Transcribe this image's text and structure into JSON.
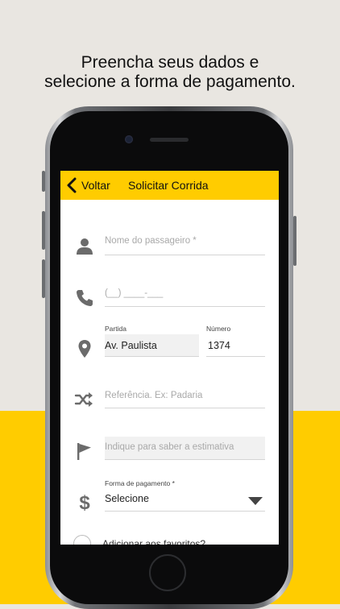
{
  "promo": {
    "line1": "Preencha seus dados e",
    "line2": "selecione a forma de pagamento."
  },
  "header": {
    "back_label": "Voltar",
    "title": "Solicitar Corrida"
  },
  "form": {
    "passenger": {
      "icon": "person-icon",
      "placeholder": "Nome do passageiro *"
    },
    "phone": {
      "icon": "phone-icon",
      "placeholder": "(__) ____-___"
    },
    "origin": {
      "icon": "location-pin-icon",
      "label": "Partida",
      "value": "Av. Paulista",
      "number_label": "Número",
      "number_value": "1374"
    },
    "reference": {
      "icon": "shuffle-icon",
      "placeholder": "Referência. Ex: Padaria"
    },
    "destination": {
      "icon": "flag-icon",
      "placeholder": "Indique para saber a estimativa"
    },
    "payment": {
      "icon": "dollar-icon",
      "label": "Forma de pagamento *",
      "value": "Selecione"
    },
    "favorite": {
      "label": "Adicionar aos favoritos?",
      "checked": false
    }
  },
  "colors": {
    "accent": "#ffcc00",
    "background": "#e9e6e1"
  }
}
